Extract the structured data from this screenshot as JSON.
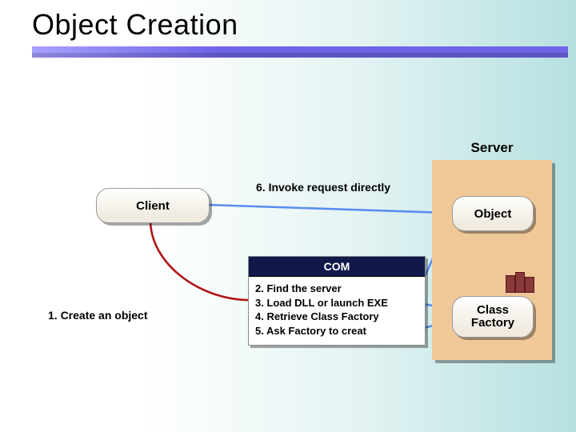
{
  "title": "Object Creation",
  "server_label": "Server",
  "client_label": "Client",
  "object_label": "Object",
  "factory_label": "Class\nFactory",
  "caption_invoke": "6. Invoke request directly",
  "caption_create": "1. Create an object",
  "com": {
    "header": "COM",
    "lines": [
      "2. Find the server",
      "3. Load DLL or launch EXE",
      "4. Retrieve Class Factory",
      "5. Ask Factory to creat"
    ]
  }
}
